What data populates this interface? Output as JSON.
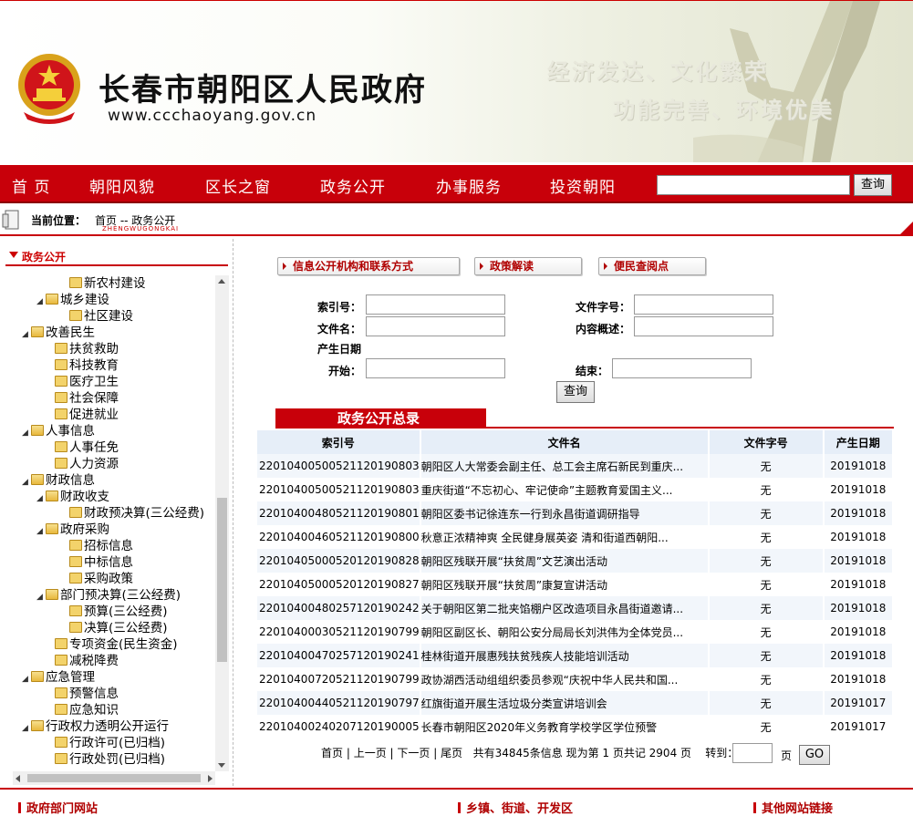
{
  "header": {
    "title": "长春市朝阳区人民政府",
    "url": "www.ccchaoyang.gov.cn",
    "slogan_line1": "经济发达、文化繁荣",
    "slogan_line2": "功能完善、环境优美",
    "emblem_icon": "national-emblem-icon"
  },
  "nav": {
    "items": [
      "首 页",
      "朝阳风貌",
      "区长之窗",
      "政务公开",
      "办事服务",
      "投资朝阳"
    ],
    "search_value": "",
    "search_button": "查询"
  },
  "breadcrumb": {
    "label": "当前位置：",
    "path": "首页 -- 政务公开",
    "pinyin": "ZHENGWUGONGKAI"
  },
  "sidebar": {
    "heading": "政务公开",
    "tree": [
      {
        "label": "新农村建设",
        "level": 2,
        "type": "leaf"
      },
      {
        "label": "城乡建设",
        "level": 1,
        "type": "open"
      },
      {
        "label": "社区建设",
        "level": 2,
        "type": "leaf"
      },
      {
        "label": "改善民生",
        "level": 0,
        "type": "open"
      },
      {
        "label": "扶贫救助",
        "level": 1,
        "type": "leaf"
      },
      {
        "label": "科技教育",
        "level": 1,
        "type": "leaf"
      },
      {
        "label": "医疗卫生",
        "level": 1,
        "type": "leaf"
      },
      {
        "label": "社会保障",
        "level": 1,
        "type": "leaf"
      },
      {
        "label": "促进就业",
        "level": 1,
        "type": "leaf"
      },
      {
        "label": "人事信息",
        "level": 0,
        "type": "open"
      },
      {
        "label": "人事任免",
        "level": 1,
        "type": "leaf"
      },
      {
        "label": "人力资源",
        "level": 1,
        "type": "leaf"
      },
      {
        "label": "财政信息",
        "level": 0,
        "type": "open"
      },
      {
        "label": "财政收支",
        "level": 1,
        "type": "open"
      },
      {
        "label": "财政预决算(三公经费)",
        "level": 2,
        "type": "leaf"
      },
      {
        "label": "政府采购",
        "level": 1,
        "type": "open"
      },
      {
        "label": "招标信息",
        "level": 2,
        "type": "leaf"
      },
      {
        "label": "中标信息",
        "level": 2,
        "type": "leaf"
      },
      {
        "label": "采购政策",
        "level": 2,
        "type": "leaf"
      },
      {
        "label": "部门预决算(三公经费)",
        "level": 1,
        "type": "open"
      },
      {
        "label": "预算(三公经费)",
        "level": 2,
        "type": "leaf"
      },
      {
        "label": "决算(三公经费)",
        "level": 2,
        "type": "leaf"
      },
      {
        "label": "专项资金(民生资金)",
        "level": 1,
        "type": "leaf"
      },
      {
        "label": "减税降费",
        "level": 1,
        "type": "leaf"
      },
      {
        "label": "应急管理",
        "level": 0,
        "type": "open"
      },
      {
        "label": "预警信息",
        "level": 1,
        "type": "leaf"
      },
      {
        "label": "应急知识",
        "level": 1,
        "type": "leaf"
      },
      {
        "label": "行政权力透明公开运行",
        "level": 0,
        "type": "open"
      },
      {
        "label": "行政许可(已归档)",
        "level": 1,
        "type": "leaf"
      },
      {
        "label": "行政处罚(已归档)",
        "level": 1,
        "type": "leaf"
      }
    ]
  },
  "main": {
    "tabs": [
      "信息公开机构和联系方式",
      "政策解读",
      "便民查阅点"
    ],
    "form": {
      "index_label": "索引号：",
      "docno_label": "文件字号：",
      "name_label": "文件名：",
      "summary_label": "内容概述：",
      "date_label": "产生日期",
      "start_label": "开始：",
      "end_label": "结束：",
      "index_value": "",
      "docno_value": "",
      "name_value": "",
      "summary_value": "",
      "start_value": "",
      "end_value": "",
      "submit": "查询"
    },
    "list_title": "政务公开总录",
    "columns": [
      "索引号",
      "文件名",
      "文件字号",
      "产生日期"
    ],
    "rows": [
      [
        "22010400500521120190803",
        "朝阳区人大常委会副主任、总工会主席石新民到重庆...",
        "无",
        "20191018"
      ],
      [
        "22010400500521120190803",
        "重庆街道“不忘初心、牢记使命”主题教育爱国主义...",
        "无",
        "20191018"
      ],
      [
        "22010400480521120190801",
        "朝阳区委书记徐连东一行到永昌街道调研指导",
        "无",
        "20191018"
      ],
      [
        "22010400460521120190800",
        "秋意正浓精神爽 全民健身展英姿 清和街道西朝阳...",
        "无",
        "20191018"
      ],
      [
        "22010405000520120190828",
        "朝阳区残联开展“扶贫周”文艺演出活动",
        "无",
        "20191018"
      ],
      [
        "22010405000520120190827",
        "朝阳区残联开展“扶贫周”康复宣讲活动",
        "无",
        "20191018"
      ],
      [
        "22010400480257120190242",
        "关于朝阳区第二批夹馅棚户区改造项目永昌街道邀请...",
        "无",
        "20191018"
      ],
      [
        "22010400030521120190799",
        "朝阳区副区长、朝阳公安分局局长刘洪伟为全体党员...",
        "无",
        "20191018"
      ],
      [
        "22010400470257120190241",
        "桂林街道开展惠残扶贫残疾人技能培训活动",
        "无",
        "20191018"
      ],
      [
        "22010400720521120190799",
        "政协湖西活动组组织委员参观“庆祝中华人民共和国...",
        "无",
        "20191018"
      ],
      [
        "22010400440521120190797",
        "红旗街道开展生活垃圾分类宣讲培训会",
        "无",
        "20191017"
      ],
      [
        "22010400240207120190005",
        "长春市朝阳区2020年义务教育学校学区学位预警",
        "无",
        "20191017"
      ]
    ],
    "pager": {
      "first": "首页",
      "prev": "上一页",
      "next": "下一页",
      "last": "尾页",
      "summary": "共有34845条信息 现为第 1 页共记 2904 页",
      "goto_label": "转到：",
      "page_suffix": "页",
      "goto_value": "",
      "go_button": "GO"
    }
  },
  "footer": {
    "links": [
      "政府部门网站",
      "乡镇、街道、开发区",
      "其他网站链接"
    ]
  },
  "colors": {
    "brand_red": "#c8000a",
    "row_alt": "#f2f6fb",
    "header_bg": "#e6eef8"
  }
}
